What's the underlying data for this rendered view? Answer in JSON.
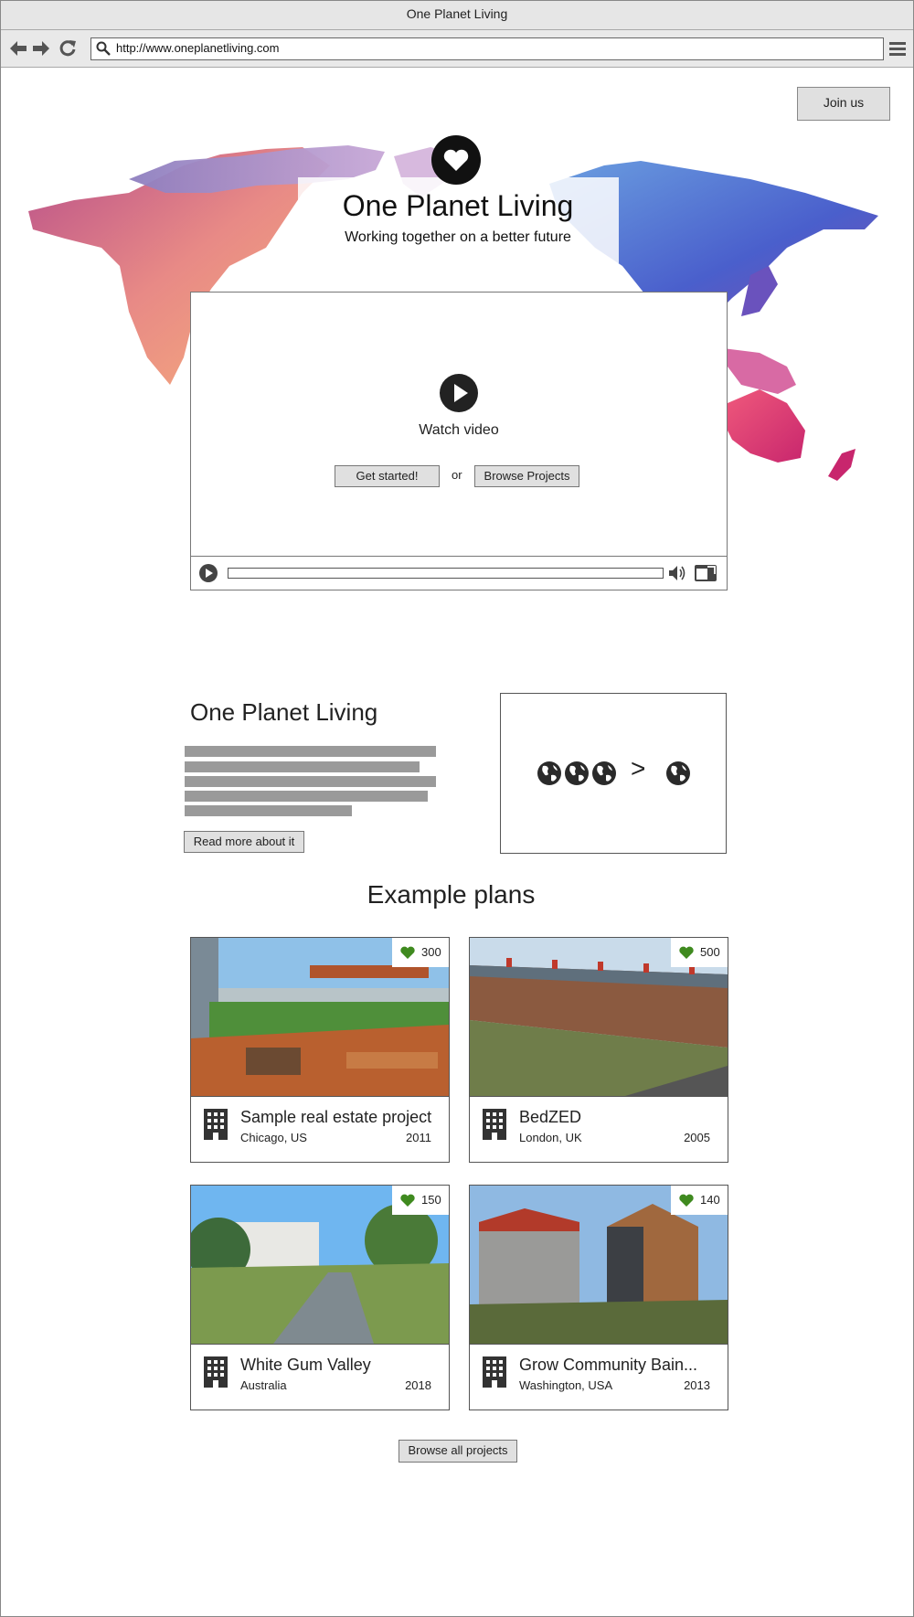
{
  "browser": {
    "window_title": "One Planet Living",
    "url": "http://www.oneplanetliving.com"
  },
  "header": {
    "join_label": "Join us"
  },
  "hero": {
    "title": "One Planet Living",
    "subtitle": "Working together on a better future",
    "video": {
      "label": "Watch video",
      "get_started": "Get started!",
      "or": "or",
      "browse_projects": "Browse Projects"
    }
  },
  "about": {
    "title": "One Planet Living",
    "read_more": "Read more about it",
    "compare_symbol": ">"
  },
  "plans": {
    "title": "Example plans",
    "items": [
      {
        "name": "Sample real estate project",
        "location": "Chicago, US",
        "year": "2011",
        "likes": "300"
      },
      {
        "name": "BedZED",
        "location": "London, UK",
        "year": "2005",
        "likes": "500"
      },
      {
        "name": "White Gum Valley",
        "location": "Australia",
        "year": "2018",
        "likes": "150"
      },
      {
        "name": "Grow Community Bain...",
        "location": "Washington, USA",
        "year": "2013",
        "likes": "140"
      }
    ],
    "browse_all": "Browse all projects"
  },
  "colors": {
    "like_heart": "#3f8a1f",
    "text_placeholder": "#9a9a9a",
    "button_bg": "#e0e0e0"
  },
  "icons": [
    "back-arrow-icon",
    "forward-arrow-icon",
    "reload-icon",
    "search-icon",
    "hamburger-menu-icon",
    "heart-icon",
    "play-icon",
    "volume-icon",
    "fullscreen-icon",
    "globe-icon",
    "building-icon"
  ]
}
